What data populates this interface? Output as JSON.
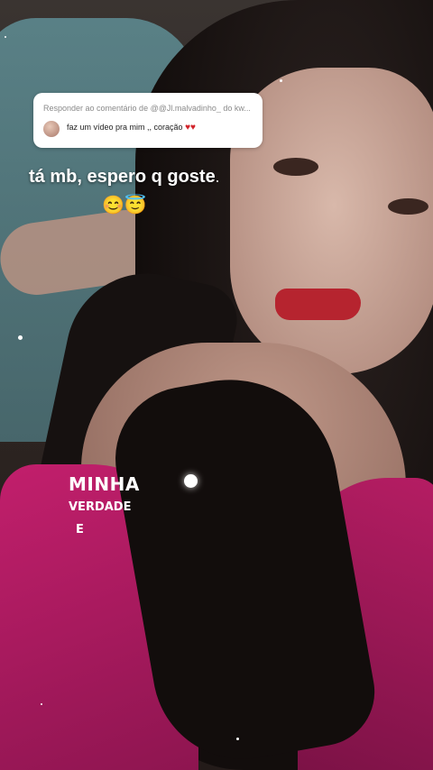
{
  "reply": {
    "title": "Responder ao comentário de @@Jl.malvadinho_ do kw...",
    "comment": "faz um vídeo pra mim ,, coração",
    "hearts": "♥♥"
  },
  "caption": {
    "text": "tá mb, espero q goste",
    "emojis": "😊😇"
  },
  "lyrics": {
    "line1": "MINHA",
    "line2": "VERDADE",
    "line3": "E"
  },
  "colors": {
    "heart": "#d2232a",
    "shirt": "#c21f6c",
    "hair": "#1a1412"
  }
}
